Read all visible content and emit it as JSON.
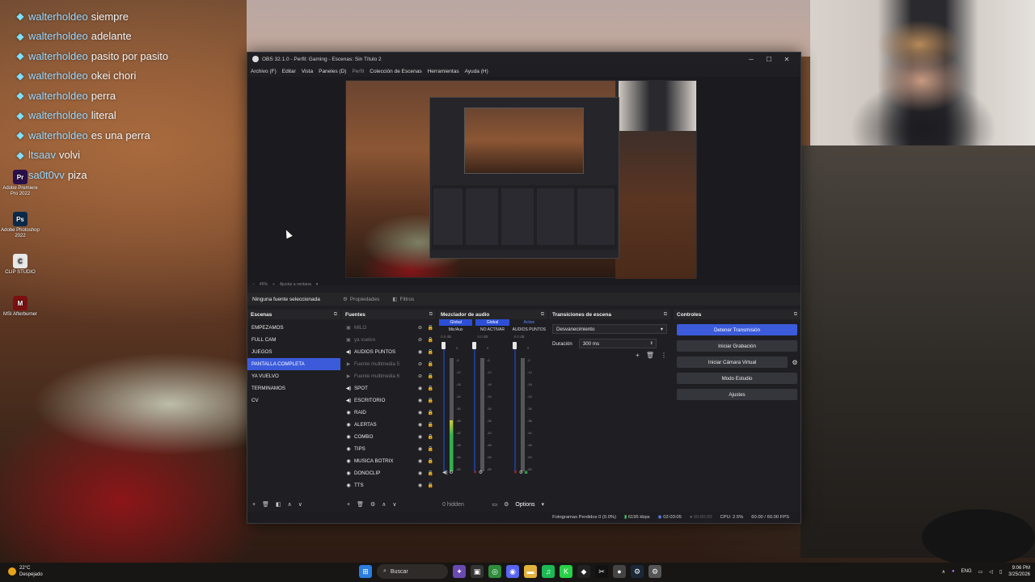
{
  "chat": [
    {
      "user": "walterholdeo",
      "msg": "siempre"
    },
    {
      "user": "walterholdeo",
      "msg": "adelante"
    },
    {
      "user": "walterholdeo",
      "msg": "pasito por pasito"
    },
    {
      "user": "walterholdeo",
      "msg": "okei chori"
    },
    {
      "user": "walterholdeo",
      "msg": "perra"
    },
    {
      "user": "walterholdeo",
      "msg": "literal"
    },
    {
      "user": "walterholdeo",
      "msg": "es una perra"
    },
    {
      "user": "ltsaav",
      "msg": "volvi"
    },
    {
      "user": "sa0t0vv",
      "msg": "piza"
    }
  ],
  "desktop_icons": [
    {
      "label": "Adobe Premiere Pro 2022",
      "icon": "premiere-icon",
      "color": "#2a0f4a",
      "glyph": "Pr"
    },
    {
      "label": "Adobe Photoshop 2022",
      "icon": "photoshop-icon",
      "color": "#0b2a4a",
      "glyph": "Ps"
    },
    {
      "label": "CLIP STUDIO",
      "icon": "clip-studio-icon",
      "color": "#e8e8e8",
      "glyph": "C"
    },
    {
      "label": "MSI Afterburner",
      "icon": "afterburner-icon",
      "color": "#7a1010",
      "glyph": "M"
    }
  ],
  "obs": {
    "title": "OBS 32.1.0 - Perfil: Gaming - Escenas: Sin Título 2",
    "menu": [
      "Archivo (F)",
      "Editar",
      "Vista",
      "Paneles (D)",
      "Perfil",
      "Colección de Escenas",
      "Herramientas",
      "Ayuda (H)"
    ],
    "menu_dim_index": 4,
    "preview_toolbar": [
      "46%",
      "Ajustar a ventana"
    ],
    "no_source": "Ninguna fuente seleccionada",
    "properties": "Propiedades",
    "filters": "Filtros",
    "scenes_title": "Escenas",
    "scenes": [
      "EMPEZAMOS",
      "FULL CAM",
      "JUEGOS",
      "PANTALLA COMPLETA",
      "YA VUELVO",
      "TERMINAMOS",
      "CV"
    ],
    "selected_scene": "PANTALLA COMPLETA",
    "sources_title": "Fuentes",
    "sources": [
      {
        "name": "MILO",
        "icon": "image-icon",
        "dim": true
      },
      {
        "name": "ya vuelvo",
        "icon": "image-icon",
        "dim": true
      },
      {
        "name": "AUDIOS PUNTOS",
        "icon": "audio-icon",
        "dim": false
      },
      {
        "name": "Fuente multimedia 5",
        "icon": "play-icon",
        "dim": true
      },
      {
        "name": "Fuente multimedia 6",
        "icon": "play-icon",
        "dim": true
      },
      {
        "name": "SPOT",
        "icon": "audio-icon",
        "dim": false
      },
      {
        "name": "ESCRITORIO",
        "icon": "audio-icon",
        "dim": false
      },
      {
        "name": "RAID",
        "icon": "browser-icon",
        "dim": false
      },
      {
        "name": "ALERTAS",
        "icon": "browser-icon",
        "dim": false
      },
      {
        "name": "COMBO",
        "icon": "browser-icon",
        "dim": false
      },
      {
        "name": "TIPS",
        "icon": "browser-icon",
        "dim": false
      },
      {
        "name": "MUSICA BOTRIX",
        "icon": "browser-icon",
        "dim": false
      },
      {
        "name": "DONOCLIP",
        "icon": "browser-icon",
        "dim": false
      },
      {
        "name": "TTS",
        "icon": "browser-icon",
        "dim": false
      }
    ],
    "mixer_title": "Mezclador de audio",
    "mixer_tabs": [
      "Global",
      "Global",
      "Active"
    ],
    "mixer_channels": [
      {
        "name": "Mic/Aux",
        "db": "0.0 dB",
        "level": 0.45
      },
      {
        "name": "NO ACTIVAR",
        "db": "0.0 dB",
        "level": 0.0
      },
      {
        "name": "AUDIOS PUNTOS",
        "db": "0.0 dB",
        "level": 0.0
      }
    ],
    "mixer_scale": [
      "0",
      "-6",
      "-12",
      "-18",
      "-24",
      "-30",
      "-36",
      "-42",
      "-48",
      "-54",
      "-60"
    ],
    "mixer_hidden": "0 hidden",
    "mixer_options": "Options",
    "transitions_title": "Transiciones de escena",
    "transition": "Desvanecimiento",
    "duration_label": "Duración",
    "duration_value": "300 ms",
    "controls_title": "Controles",
    "controls": {
      "stop_stream": "Detener Transmisión",
      "start_record": "Iniciar Grabación",
      "virtual_cam": "Iniciar Cámara Virtual",
      "studio_mode": "Modo Estudio",
      "settings": "Ajustes"
    },
    "status": {
      "dropped": "Fotogramas Perdidos 0 (0.0%)",
      "bitrate": "6195 kbps",
      "stream_time": "02:03:05",
      "rec_time": "00:00:00",
      "cpu": "CPU: 2.5%",
      "fps": "60.00 / 60.00 FPS"
    }
  },
  "taskbar": {
    "temp": "22°C",
    "weather": "Despejado",
    "search": "Buscar",
    "lang": "ENG",
    "time": "9:06 PM",
    "date": "3/25/2026"
  }
}
